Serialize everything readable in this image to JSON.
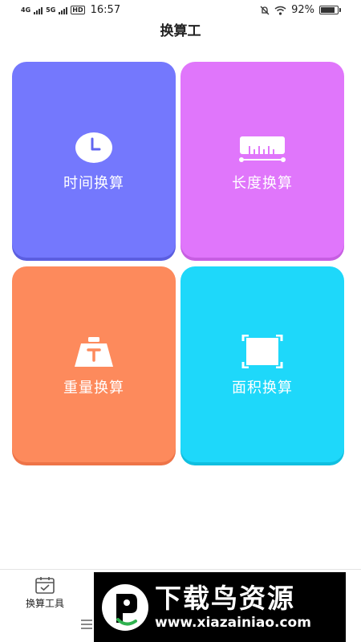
{
  "status_bar": {
    "network_1": "4G",
    "network_2": "5G",
    "hd": "HD",
    "time": "16:57",
    "battery": "92%",
    "battery_level": 0.92
  },
  "header": {
    "title": "换算工"
  },
  "tiles": [
    {
      "label": "时间换算",
      "icon": "clock-icon",
      "color": "#7478fd"
    },
    {
      "label": "长度换算",
      "icon": "ruler-icon",
      "color": "#e076fb"
    },
    {
      "label": "重量换算",
      "icon": "weight-icon",
      "color": "#fd8a5c"
    },
    {
      "label": "面积换算",
      "icon": "area-icon",
      "color": "#1ed8fa"
    }
  ],
  "tab_bar": {
    "tabs": [
      {
        "label": "换算工具",
        "icon": "calendar-icon"
      }
    ],
    "nav_icon": "menu-icon"
  },
  "watermark": {
    "title": "下载鸟资源",
    "url": "www.xiazainiao.com"
  }
}
